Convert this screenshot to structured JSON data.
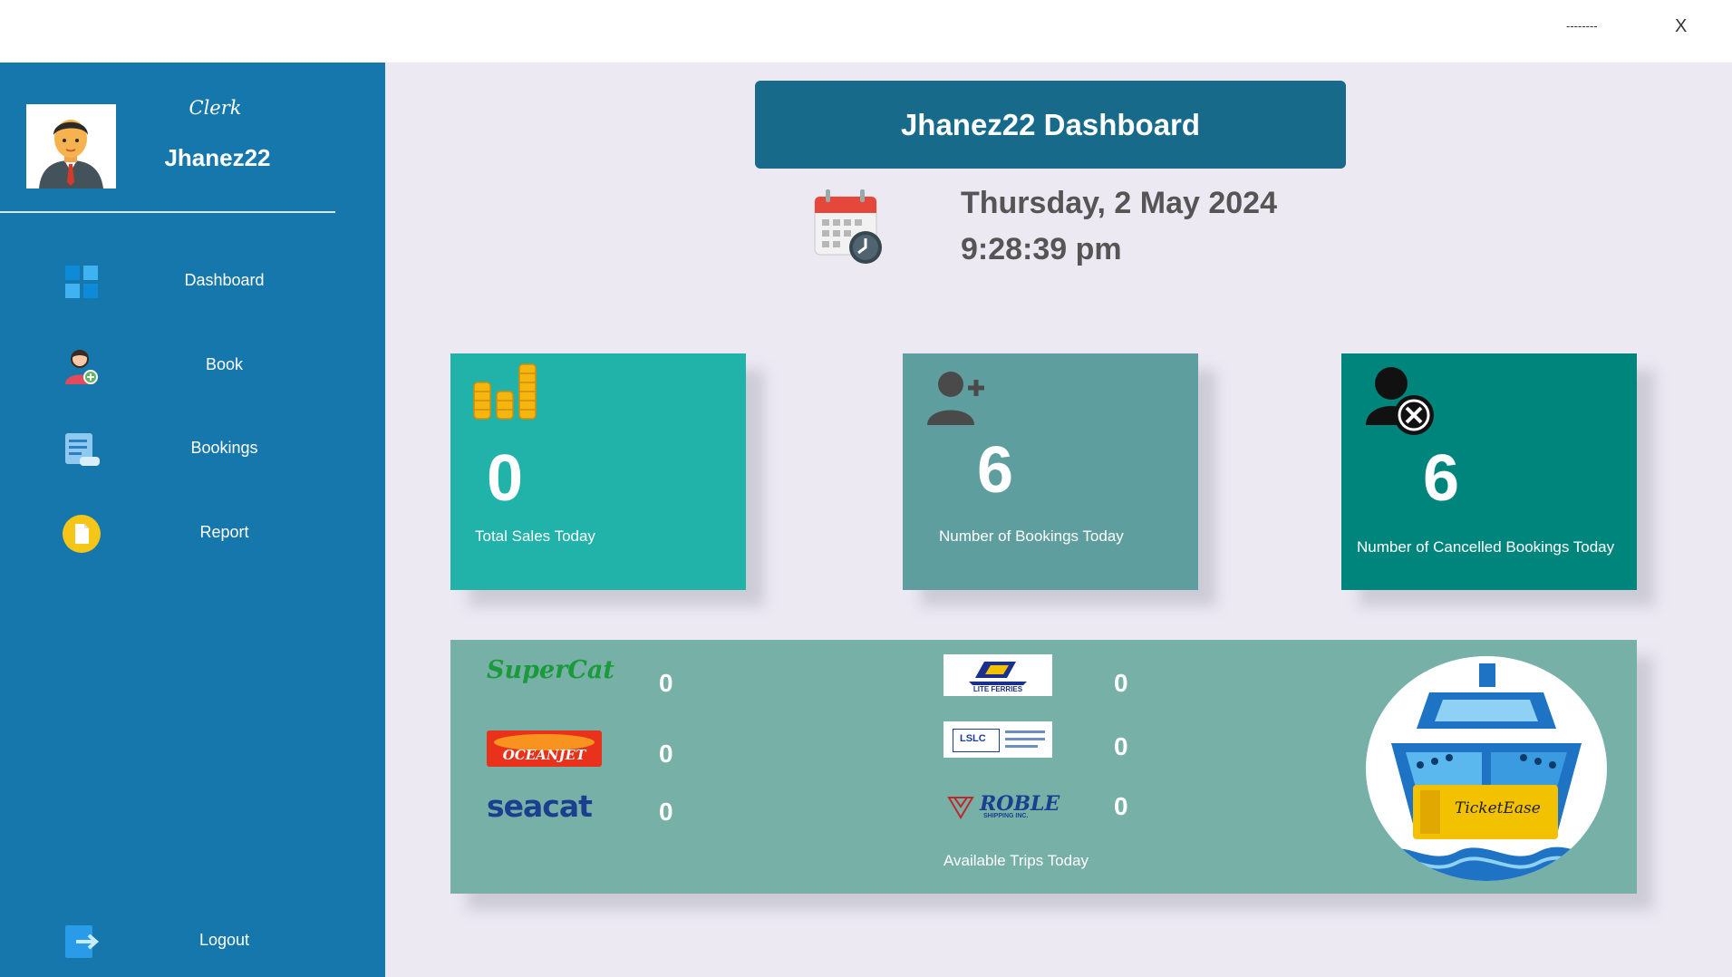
{
  "window": {
    "minimize_label": "--------",
    "close_label": "X"
  },
  "user": {
    "role": "Clerk",
    "name": "Jhanez22"
  },
  "nav": [
    {
      "label": "Dashboard",
      "icon": "dashboard-icon"
    },
    {
      "label": "Book",
      "icon": "book-user-icon"
    },
    {
      "label": "Bookings",
      "icon": "bookings-list-icon"
    },
    {
      "label": "Report",
      "icon": "report-icon"
    },
    {
      "label": "Logout",
      "icon": "logout-icon"
    }
  ],
  "header": {
    "title": "Jhanez22 Dashboard"
  },
  "datetime": {
    "date": "Thursday, 2 May 2024",
    "time": "9:28:39 pm"
  },
  "cards": [
    {
      "value": "0",
      "label": "Total Sales Today",
      "color": "#21b2a9",
      "icon": "coins-chart-icon"
    },
    {
      "value": "6",
      "label": "Number of Bookings Today",
      "color": "#5f9e9f",
      "icon": "add-user-icon"
    },
    {
      "value": "6",
      "label": "Number of Cancelled Bookings Today",
      "color": "#00857d",
      "icon": "cancel-user-icon"
    }
  ],
  "trips": {
    "caption": "Available Trips Today",
    "companies": [
      {
        "name": "SuperCat",
        "count": "0"
      },
      {
        "name": "OCEANJET",
        "count": "0"
      },
      {
        "name": "seacat",
        "count": "0"
      },
      {
        "name": "LITE FERRIES",
        "count": "0"
      },
      {
        "name": "LSLC",
        "count": "0"
      },
      {
        "name": "ROBLE",
        "sub": "SHIPPING INC.",
        "count": "0"
      }
    ],
    "brand": "TicketEase"
  },
  "colors": {
    "sidebar": "#1677ad",
    "header": "#186a8a",
    "background": "#ece9f3",
    "trips_panel": "#77b0a7"
  }
}
